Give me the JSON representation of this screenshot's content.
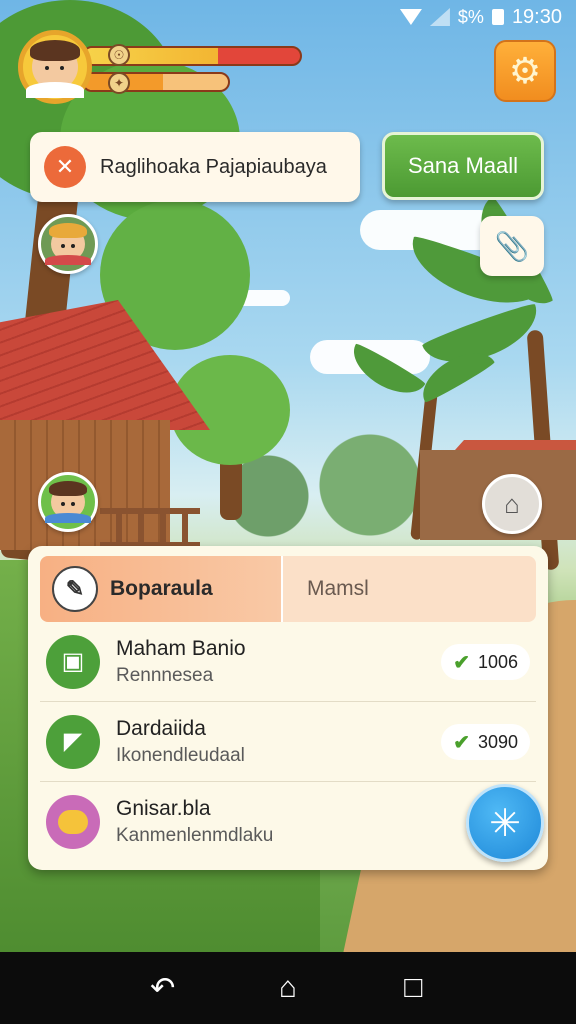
{
  "status_bar": {
    "signal_text": "$%",
    "time": "19:30"
  },
  "hud": {
    "player_avatar": "player-portrait",
    "health_bar": {
      "fill_fraction": 0.62,
      "colors": [
        "#f3c339",
        "#e2463a"
      ]
    },
    "energy_bar": {
      "fill_fraction": 0.55,
      "color": "#f39a2a"
    },
    "settings_icon": "gear-icon"
  },
  "quest": {
    "icon": "quest-cancel-icon",
    "text": "Raglihoaka Pajapiaubaya"
  },
  "action_button": {
    "label": "Sana Maall"
  },
  "panel": {
    "tabs": [
      {
        "label": "Boparaula",
        "icon": "pencil-icon",
        "active": true
      },
      {
        "label": "Mamsl",
        "active": false
      }
    ],
    "rows": [
      {
        "title": "Maham Banio",
        "subtitle": "Rennnesea",
        "reward": "1006",
        "icon_color": "#4da03a",
        "icon": "ticket-icon"
      },
      {
        "title": "Dardaiida",
        "subtitle": "Ikonendleudaal",
        "reward": "3090",
        "icon_color": "#4da03a",
        "icon": "paper-icon"
      },
      {
        "title": "Gnisar.bla",
        "subtitle": "Kanmenlenmdlaku",
        "reward": "",
        "icon_color": "#c96bb8",
        "icon": "chat-bubble-icon"
      }
    ]
  },
  "colors": {
    "accent_orange": "#f18d1f",
    "accent_green": "#4c9a33",
    "accent_blue": "#1e88d8",
    "panel_bg": "#fdf9e8"
  }
}
